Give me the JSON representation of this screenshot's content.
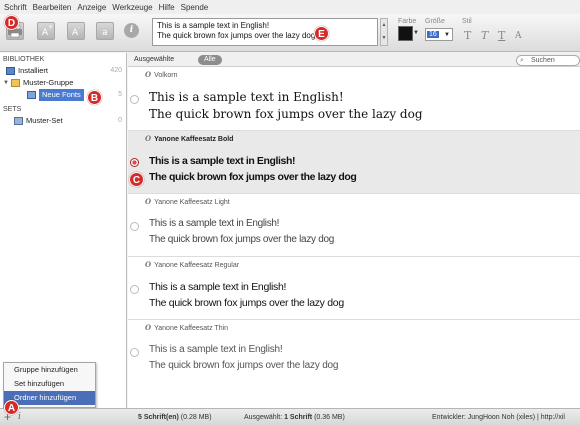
{
  "menu": [
    "Schrift",
    "Bearbeiten",
    "Anzeige",
    "Werkzeuge",
    "Hilfe",
    "Spende"
  ],
  "toolbar": {
    "preview_line1": "This is a sample text in English!",
    "preview_line2": "The quick brown fox jumps over the lazy dog",
    "color_label": "Farbe",
    "size_label": "Größe",
    "style_label": "Stil",
    "size_value": "16",
    "style_buttons": [
      "T",
      "T",
      "T",
      "A"
    ]
  },
  "markers": {
    "a": "A",
    "b": "B",
    "c": "C",
    "d": "D",
    "e": "E"
  },
  "sidebar": {
    "library_header": "BIBLIOTHEK",
    "installed": {
      "label": "Installiert",
      "count": "420"
    },
    "group": {
      "label": "Muster-Gruppe"
    },
    "new_fonts": {
      "label": "Neue Fonts",
      "count": "5"
    },
    "sets_header": "SETS",
    "muster_set": {
      "label": "Muster-Set",
      "count": "0"
    }
  },
  "context_menu": [
    "Gruppe hinzufügen",
    "Set hinzufügen",
    "Ordner hinzufügen"
  ],
  "main_head": {
    "selected_label": "Ausgewählte",
    "all_label": "Alle",
    "search_placeholder": "Suchen"
  },
  "fonts": [
    {
      "name": "Volkorn",
      "line1": "This is a sample text in English!",
      "line2": "The quick brown fox jumps over the lazy dog",
      "selected": false
    },
    {
      "name": "Yanone Kaffeesatz Bold",
      "line1": "This is a sample text in English!",
      "line2": "The quick brown fox jumps over the lazy dog",
      "selected": true
    },
    {
      "name": "Yanone Kaffeesatz Light",
      "line1": "This is a sample text in English!",
      "line2": "The quick brown fox jumps over the lazy dog",
      "selected": false
    },
    {
      "name": "Yanone Kaffeesatz Regular",
      "line1": "This is a sample text in English!",
      "line2": "The quick brown fox jumps over the lazy dog",
      "selected": false
    },
    {
      "name": "Yanone Kaffeesatz Thin",
      "line1": "This is a sample text in English!",
      "line2": "The quick brown fox jumps over the lazy dog",
      "selected": false
    }
  ],
  "status": {
    "fonts_count": "5 Schrift(en)",
    "fonts_size": "(0.28 MB)",
    "selected_label": "Ausgewählt:",
    "selected_count": "1 Schrift",
    "selected_size": "(0.36 MB)",
    "developer": "Entwickler: JungHoon Noh (xiles) | http://xil"
  }
}
